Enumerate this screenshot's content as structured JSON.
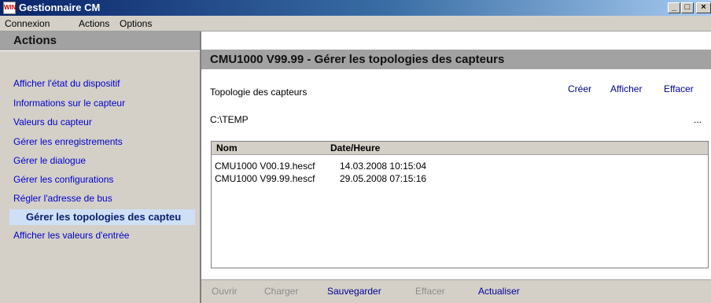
{
  "window": {
    "title": "Gestionnaire CM",
    "icon_text": "WIN",
    "buttons": [
      "_",
      "□",
      "×"
    ]
  },
  "menubar": [
    "Connexion",
    "Actions",
    "Options"
  ],
  "sidebar": {
    "title": "Actions",
    "items": [
      {
        "label": "Afficher l'état du dispositif",
        "active": false
      },
      {
        "label": "Informations sur le capteur",
        "active": false
      },
      {
        "label": "Valeurs du capteur",
        "active": false
      },
      {
        "label": "Gérer les enregistrements",
        "active": false
      },
      {
        "label": "Gérer le dialogue",
        "active": false
      },
      {
        "label": "Gérer les configurations",
        "active": false
      },
      {
        "label": "Régler l'adresse de bus",
        "active": false
      },
      {
        "label": "Gérer les topologies des capteu",
        "active": true
      },
      {
        "label": "Afficher les valeurs d'entrée",
        "active": false
      }
    ]
  },
  "main": {
    "title": "CMU1000 V99.99 - Gérer les topologies des capteurs",
    "section_label": "Topologie des capteurs",
    "actions": [
      "Créer",
      "Afficher",
      "Effacer"
    ],
    "path": "C:\\TEMP",
    "browse_label": "...",
    "table": {
      "columns": [
        "Nom",
        "Date/Heure"
      ],
      "rows": [
        [
          "CMU1000 V00.19.hescf",
          "14.03.2008  10:15:04"
        ],
        [
          "CMU1000 V99.99.hescf",
          "29.05.2008  07:15:16"
        ]
      ]
    },
    "bottom_buttons": [
      {
        "label": "Ouvrir",
        "enabled": false
      },
      {
        "label": "Charger",
        "enabled": false
      },
      {
        "label": "Sauvegarder",
        "enabled": true
      },
      {
        "label": "Effacer",
        "enabled": false
      },
      {
        "label": "Actualiser",
        "enabled": true
      }
    ]
  },
  "colors": {
    "titlebar_start": "#0a246a",
    "titlebar_end": "#a6caf0",
    "panel_header": "#a2a2a2",
    "link": "#0000cc",
    "active_item_bg": "#cfe0f6",
    "disabled_text": "#8c8c8c"
  }
}
